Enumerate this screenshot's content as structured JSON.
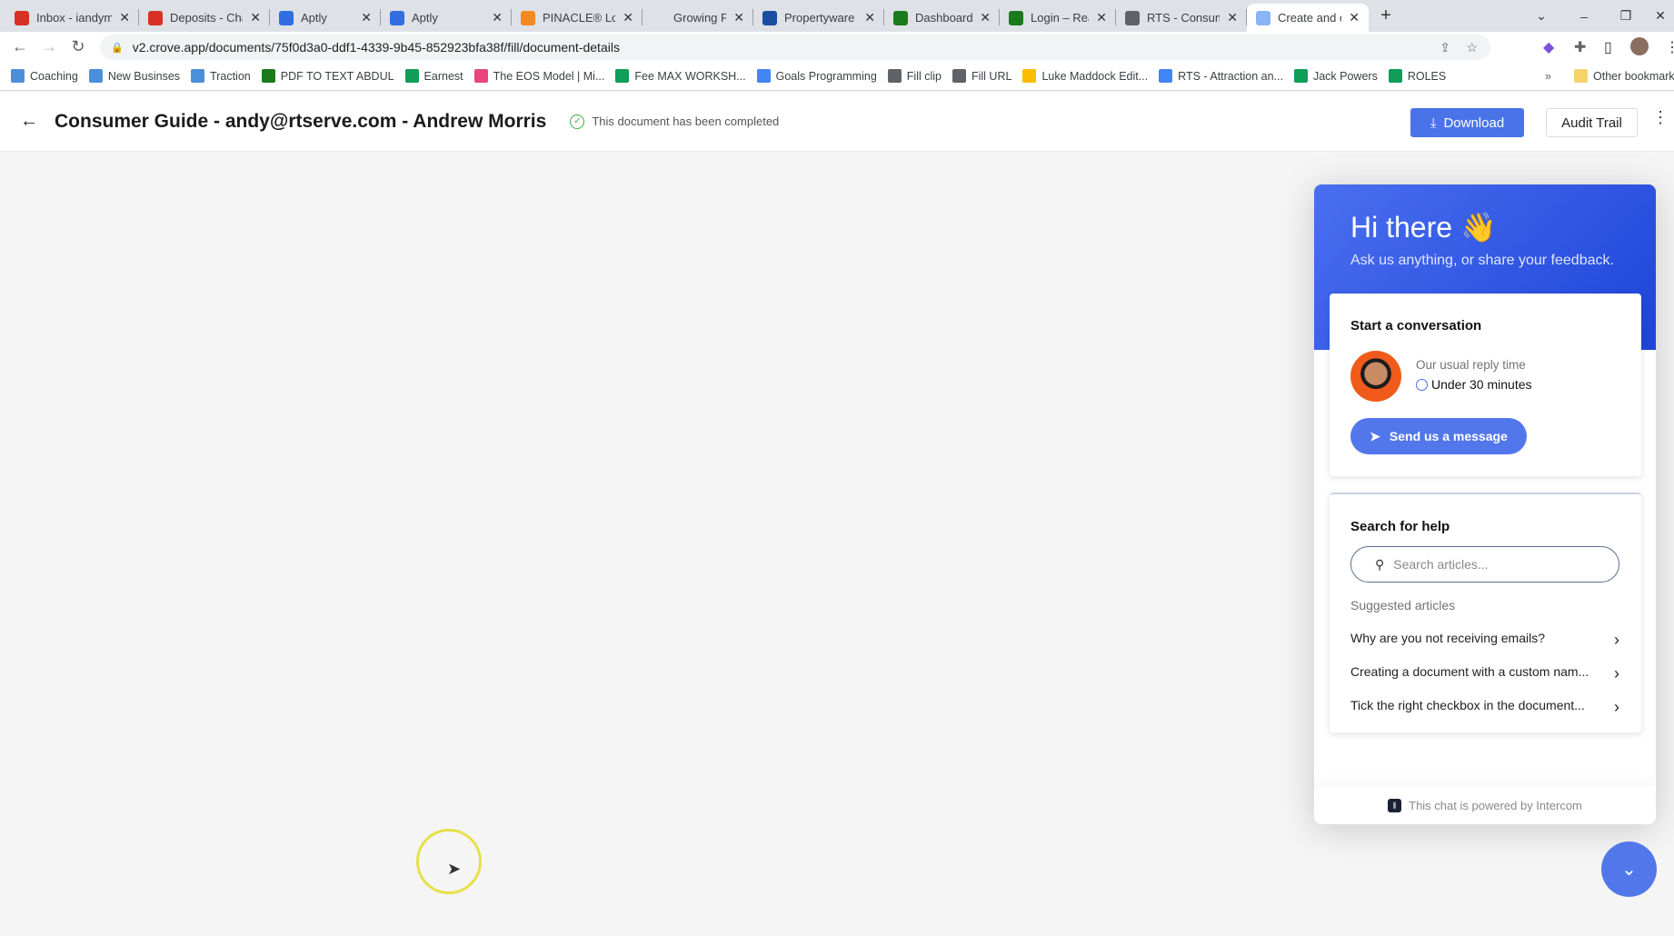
{
  "browser": {
    "tabs": [
      {
        "title": "Inbox - iandym",
        "icon": "gmail-icon",
        "color": "#d93025"
      },
      {
        "title": "Deposits - Cha",
        "icon": "gmail-icon",
        "color": "#d93025"
      },
      {
        "title": "Aptly",
        "icon": "aptly-icon",
        "color": "#2f6de1"
      },
      {
        "title": "Aptly",
        "icon": "aptly-icon",
        "color": "#2f6de1"
      },
      {
        "title": "PINACLE® Log",
        "icon": "pinacle-icon",
        "color": "#f28a21"
      },
      {
        "title": "Growing Prosp",
        "icon": "",
        "color": ""
      },
      {
        "title": "Propertyware -",
        "icon": "propertyware-icon",
        "color": "#1a4fa0"
      },
      {
        "title": "Dashboard ‹ Re",
        "icon": "leaf-icon",
        "color": "#1b7a1b"
      },
      {
        "title": "Login – Realty",
        "icon": "leaf-icon",
        "color": "#1b7a1b"
      },
      {
        "title": "RTS - Consume",
        "icon": "globe-icon",
        "color": "#5f6368"
      },
      {
        "title": "Create and cor",
        "icon": "crove-icon",
        "color": "#8ab4f8",
        "active": true
      }
    ],
    "url": "v2.crove.app/documents/75f0d3a0-ddf1-4339-9b45-852923bfa38f/fill/document-details",
    "bookmarks": [
      {
        "label": "Coaching",
        "color": "#4a90d9"
      },
      {
        "label": "New Businses",
        "color": "#4a90d9"
      },
      {
        "label": "Traction",
        "color": "#4a90d9"
      },
      {
        "label": "PDF TO TEXT ABDUL",
        "color": "#1b7a1b"
      },
      {
        "label": "Earnest",
        "color": "#0f9d58"
      },
      {
        "label": "The EOS Model | Mi...",
        "color": "#e8467c"
      },
      {
        "label": "Fee MAX WORKSH...",
        "color": "#0f9d58"
      },
      {
        "label": "Goals Programming",
        "color": "#4285f4"
      },
      {
        "label": "Fill clip",
        "color": "#5f6368"
      },
      {
        "label": "Fill URL",
        "color": "#5f6368"
      },
      {
        "label": "Luke Maddock Edit...",
        "color": "#fbbc04"
      },
      {
        "label": "RTS - Attraction an...",
        "color": "#4285f4"
      },
      {
        "label": "Jack Powers",
        "color": "#0f9d58"
      },
      {
        "label": "ROLES",
        "color": "#0f9d58"
      }
    ],
    "other_bookmarks": "Other bookmarks"
  },
  "header": {
    "title": "Consumer Guide - andy@rtserve.com - Andrew Morris",
    "status": "This document has been completed",
    "download": "Download",
    "audit_trail": "Audit Trail"
  },
  "widget": {
    "greeting": "Hi there",
    "emoji": "👋",
    "subtitle": "Ask us anything, or share your feedback.",
    "conversation": {
      "title": "Start a conversation",
      "reply_label": "Our usual reply time",
      "reply_time": "Under 30 minutes",
      "send": "Send us a message"
    },
    "help": {
      "title": "Search for help",
      "placeholder": "Search articles...",
      "suggested": "Suggested articles",
      "articles": [
        "Why are you not receiving emails?",
        "Creating a document with a custom nam...",
        "Tick the right checkbox in the document..."
      ]
    },
    "footer": "This chat is powered by Intercom",
    "accent": "#4a6ff0"
  }
}
